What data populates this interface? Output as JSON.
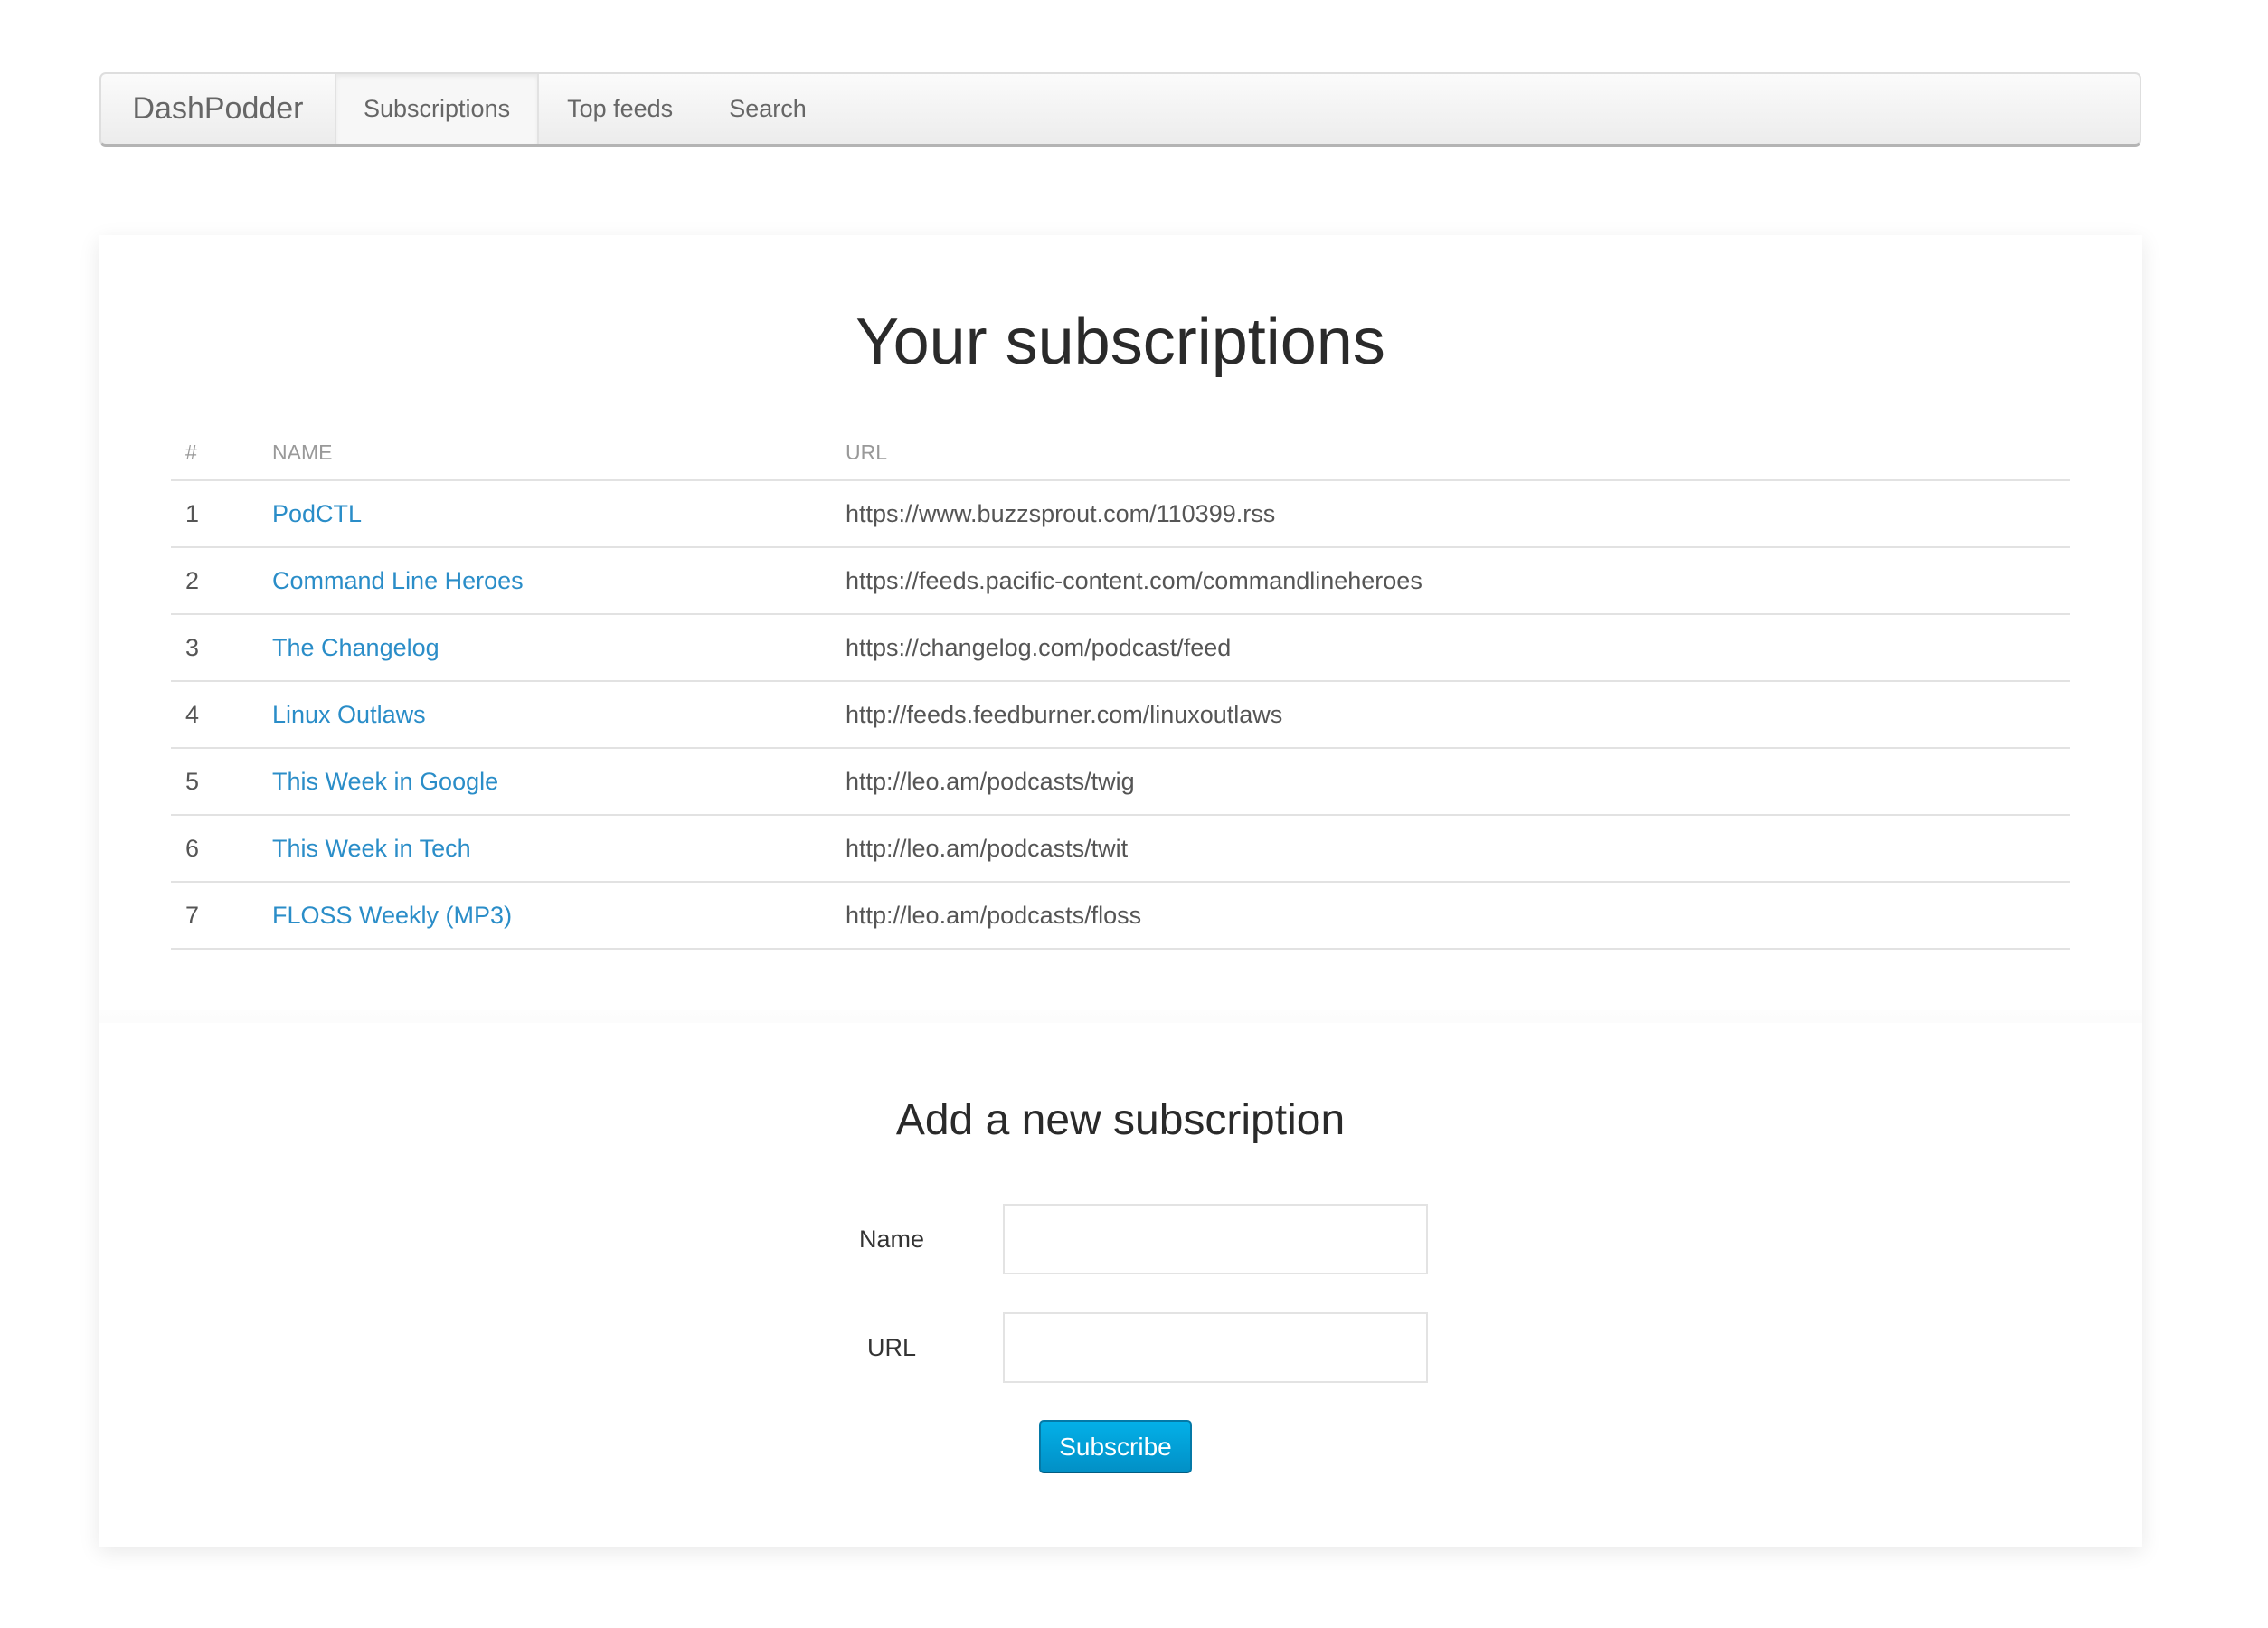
{
  "navbar": {
    "brand": "DashPodder",
    "items": [
      {
        "label": "Subscriptions",
        "active": true
      },
      {
        "label": "Top feeds",
        "active": false
      },
      {
        "label": "Search",
        "active": false
      }
    ]
  },
  "subscriptions": {
    "title": "Your subscriptions",
    "columns": [
      "#",
      "NAME",
      "URL"
    ],
    "rows": [
      {
        "num": "1",
        "name": "PodCTL",
        "url": "https://www.buzzsprout.com/110399.rss"
      },
      {
        "num": "2",
        "name": "Command Line Heroes",
        "url": "https://feeds.pacific-content.com/commandlineheroes"
      },
      {
        "num": "3",
        "name": "The Changelog",
        "url": "https://changelog.com/podcast/feed"
      },
      {
        "num": "4",
        "name": "Linux Outlaws",
        "url": "http://feeds.feedburner.com/linuxoutlaws"
      },
      {
        "num": "5",
        "name": "This Week in Google",
        "url": "http://leo.am/podcasts/twig"
      },
      {
        "num": "6",
        "name": "This Week in Tech",
        "url": "http://leo.am/podcasts/twit"
      },
      {
        "num": "7",
        "name": "FLOSS Weekly (MP3)",
        "url": "http://leo.am/podcasts/floss"
      }
    ]
  },
  "add_form": {
    "title": "Add a new subscription",
    "name_label": "Name",
    "name_value": "",
    "url_label": "URL",
    "url_value": "",
    "submit_label": "Subscribe"
  },
  "colors": {
    "link": "#2a8dc8",
    "primary_button": "#0299d4"
  }
}
